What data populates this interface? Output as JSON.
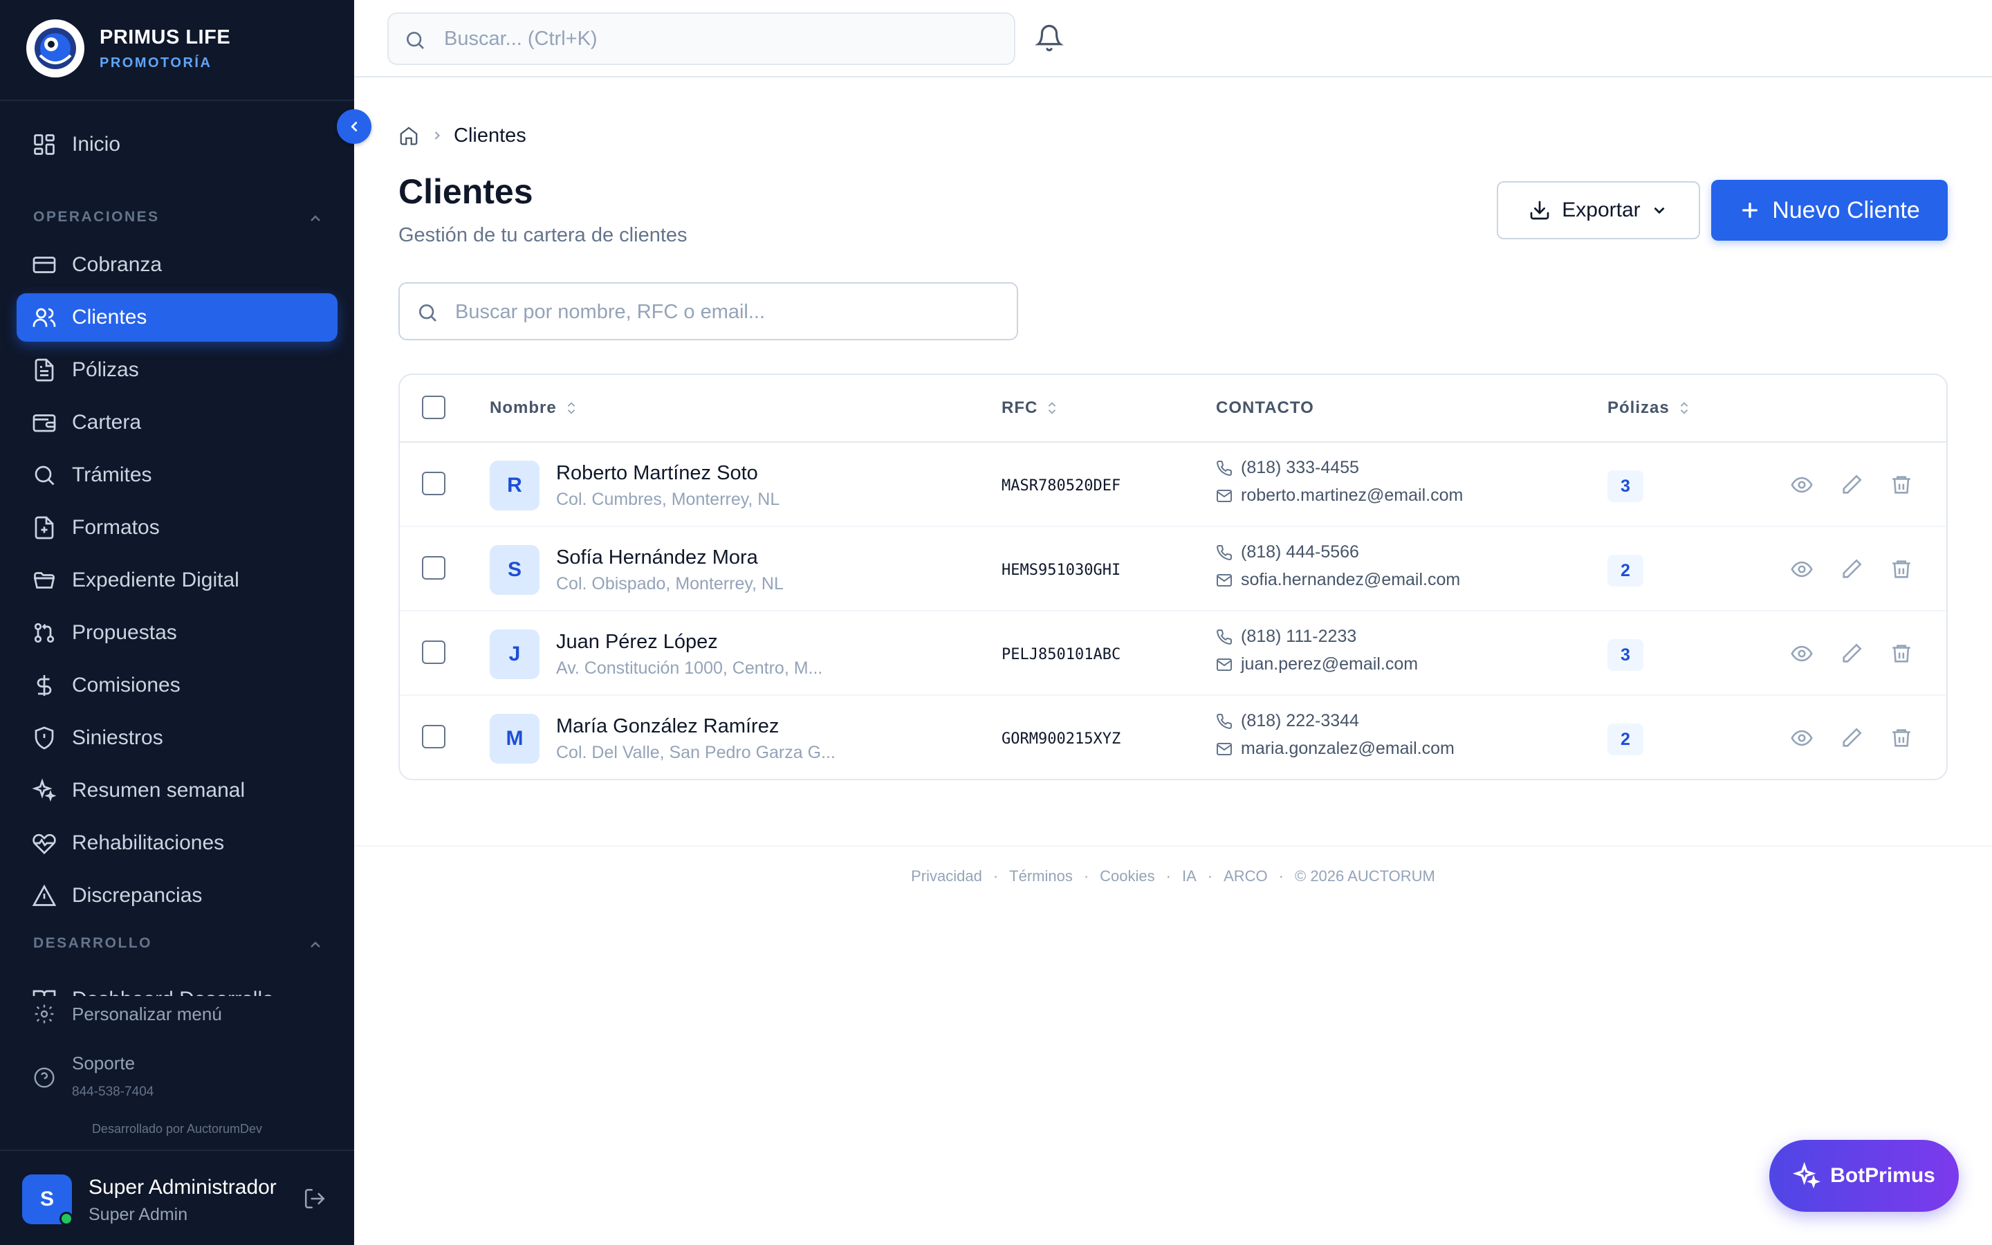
{
  "brand": {
    "name": "PRIMUS LIFE",
    "subtitle": "PROMOTORÍA"
  },
  "sidebar": {
    "home": {
      "label": "Inicio",
      "icon": "dashboard-grid-icon"
    },
    "sections": [
      {
        "label": "OPERACIONES"
      },
      {
        "label": "DESARROLLO"
      }
    ],
    "items": [
      {
        "label": "Cobranza",
        "icon": "credit-card-icon"
      },
      {
        "label": "Clientes",
        "icon": "users-icon",
        "active": true
      },
      {
        "label": "Pólizas",
        "icon": "document-icon"
      },
      {
        "label": "Cartera",
        "icon": "wallet-icon"
      },
      {
        "label": "Trámites",
        "icon": "search-icon"
      },
      {
        "label": "Formatos",
        "icon": "file-plus-icon"
      },
      {
        "label": "Expediente Digital",
        "icon": "folder-open-icon"
      },
      {
        "label": "Propuestas",
        "icon": "git-pull-request-icon"
      },
      {
        "label": "Comisiones",
        "icon": "dollar-icon"
      },
      {
        "label": "Siniestros",
        "icon": "shield-icon"
      },
      {
        "label": "Resumen semanal",
        "icon": "sparkles-icon"
      },
      {
        "label": "Rehabilitaciones",
        "icon": "heart-pulse-icon"
      },
      {
        "label": "Discrepancias",
        "icon": "alert-triangle-icon"
      }
    ],
    "dev_item": {
      "label": "Dashboard Desarrollo",
      "icon": "book-open-icon"
    },
    "customize": "Personalizar menú",
    "support": {
      "label": "Soporte",
      "phone": "844-538-7404"
    },
    "credit": "Desarrollado por AuctorumDev",
    "user": {
      "initial": "S",
      "name": "Super Administrador",
      "role": "Super Admin"
    }
  },
  "topbar": {
    "search_placeholder": "Buscar... (Ctrl+K)"
  },
  "breadcrumb": {
    "current": "Clientes"
  },
  "page": {
    "title": "Clientes",
    "subtitle": "Gestión de tu cartera de clientes",
    "export_label": "Exportar",
    "new_label": "Nuevo Cliente",
    "search_placeholder": "Buscar por nombre, RFC o email..."
  },
  "table": {
    "columns": {
      "name": "Nombre",
      "rfc": "RFC",
      "contact": "CONTACTO",
      "policies": "Pólizas"
    },
    "rows": [
      {
        "initial": "R",
        "name": "Roberto Martínez Soto",
        "address": "Col. Cumbres, Monterrey, NL",
        "rfc": "MASR780520DEF",
        "phone": "(818) 333-4455",
        "email": "roberto.martinez@email.com",
        "policies": "3"
      },
      {
        "initial": "S",
        "name": "Sofía Hernández Mora",
        "address": "Col. Obispado, Monterrey, NL",
        "rfc": "HEMS951030GHI",
        "phone": "(818) 444-5566",
        "email": "sofia.hernandez@email.com",
        "policies": "2"
      },
      {
        "initial": "J",
        "name": "Juan Pérez López",
        "address": "Av. Constitución 1000, Centro, M...",
        "rfc": "PELJ850101ABC",
        "phone": "(818) 111-2233",
        "email": "juan.perez@email.com",
        "policies": "3"
      },
      {
        "initial": "M",
        "name": "María González Ramírez",
        "address": "Col. Del Valle, San Pedro Garza G...",
        "rfc": "GORM900215XYZ",
        "phone": "(818) 222-3344",
        "email": "maria.gonzalez@email.com",
        "policies": "2"
      }
    ]
  },
  "footer": {
    "links": [
      "Privacidad",
      "Términos",
      "Cookies",
      "IA",
      "ARCO"
    ],
    "separator": "·",
    "copyright": "© 2026 AUCTORUM"
  },
  "bot": {
    "label": "BotPrimus"
  },
  "colors": {
    "accent": "#2563eb",
    "sidebar_bg": "#0f172a",
    "bot_gradient_start": "#4f46e5",
    "bot_gradient_end": "#7c3aed"
  }
}
